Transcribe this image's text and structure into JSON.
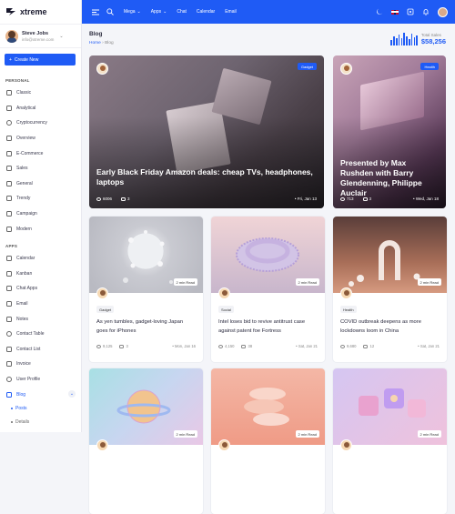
{
  "app": {
    "brand": "xtreme",
    "accent": "#1f5bf5"
  },
  "user": {
    "name": "Steve Jobs",
    "email": "info@xtreme.com"
  },
  "sidebar": {
    "create_label": "Create New",
    "personal_label": "PERSONAL",
    "personal_items": [
      "Classic",
      "Analytical",
      "Cryptocurrency",
      "Overview",
      "E-Commerce",
      "Sales",
      "General",
      "Trendy",
      "Campaign",
      "Modern"
    ],
    "apps_label": "APPS",
    "app_items": [
      "Calendar",
      "Kanban",
      "Chat Apps",
      "Email",
      "Notes",
      "Contact Table",
      "Contact List",
      "Invoice",
      "User Profile",
      "Blog"
    ],
    "blog_sub": [
      "Posts",
      "Details"
    ]
  },
  "topbar": {
    "nav": [
      "Mega",
      "Apps",
      "Chat",
      "Calendar",
      "Email"
    ]
  },
  "page": {
    "title": "Blog",
    "crumb_home": "Home",
    "crumb_current": "Blog"
  },
  "sales": {
    "label": "Total Sales",
    "value": "$58,256",
    "bars": [
      0.45,
      0.7,
      0.55,
      0.85,
      0.6,
      1.0,
      0.75,
      0.5,
      0.9,
      0.65,
      0.8
    ]
  },
  "featured": [
    {
      "tag": "Gadget",
      "title": "Early Black Friday Amazon deals: cheap TVs, headphones, laptops",
      "views": "6006",
      "comments": "3",
      "date": "Fri, Jan 13"
    },
    {
      "tag": "Health",
      "title": "Presented by Max Rushden with Barry Glendenning, Philippe Auclair",
      "views": "713",
      "comments": "3",
      "date": "Wed, Jan 18"
    }
  ],
  "posts": [
    {
      "read": "2 min Read",
      "tag": "Gadget",
      "title": "As yen tumbles, gadget-loving Japan goes for iPhones",
      "views": "9,125",
      "comments": "3",
      "date": "Mon, Jan 16"
    },
    {
      "read": "2 min Read",
      "tag": "Social",
      "title": "Intel loses bid to revive antitrust case against patent foe Fortress",
      "views": "4,150",
      "comments": "38",
      "date": "Sat, Jan 21"
    },
    {
      "read": "2 min Read",
      "tag": "Health",
      "title": "COVID outbreak deepens as more lockdowns loom in China",
      "views": "9,680",
      "comments": "12",
      "date": "Sat, Jan 21"
    },
    {
      "read": "2 min Read"
    },
    {
      "read": "2 min Read"
    },
    {
      "read": "2 min Read"
    }
  ]
}
